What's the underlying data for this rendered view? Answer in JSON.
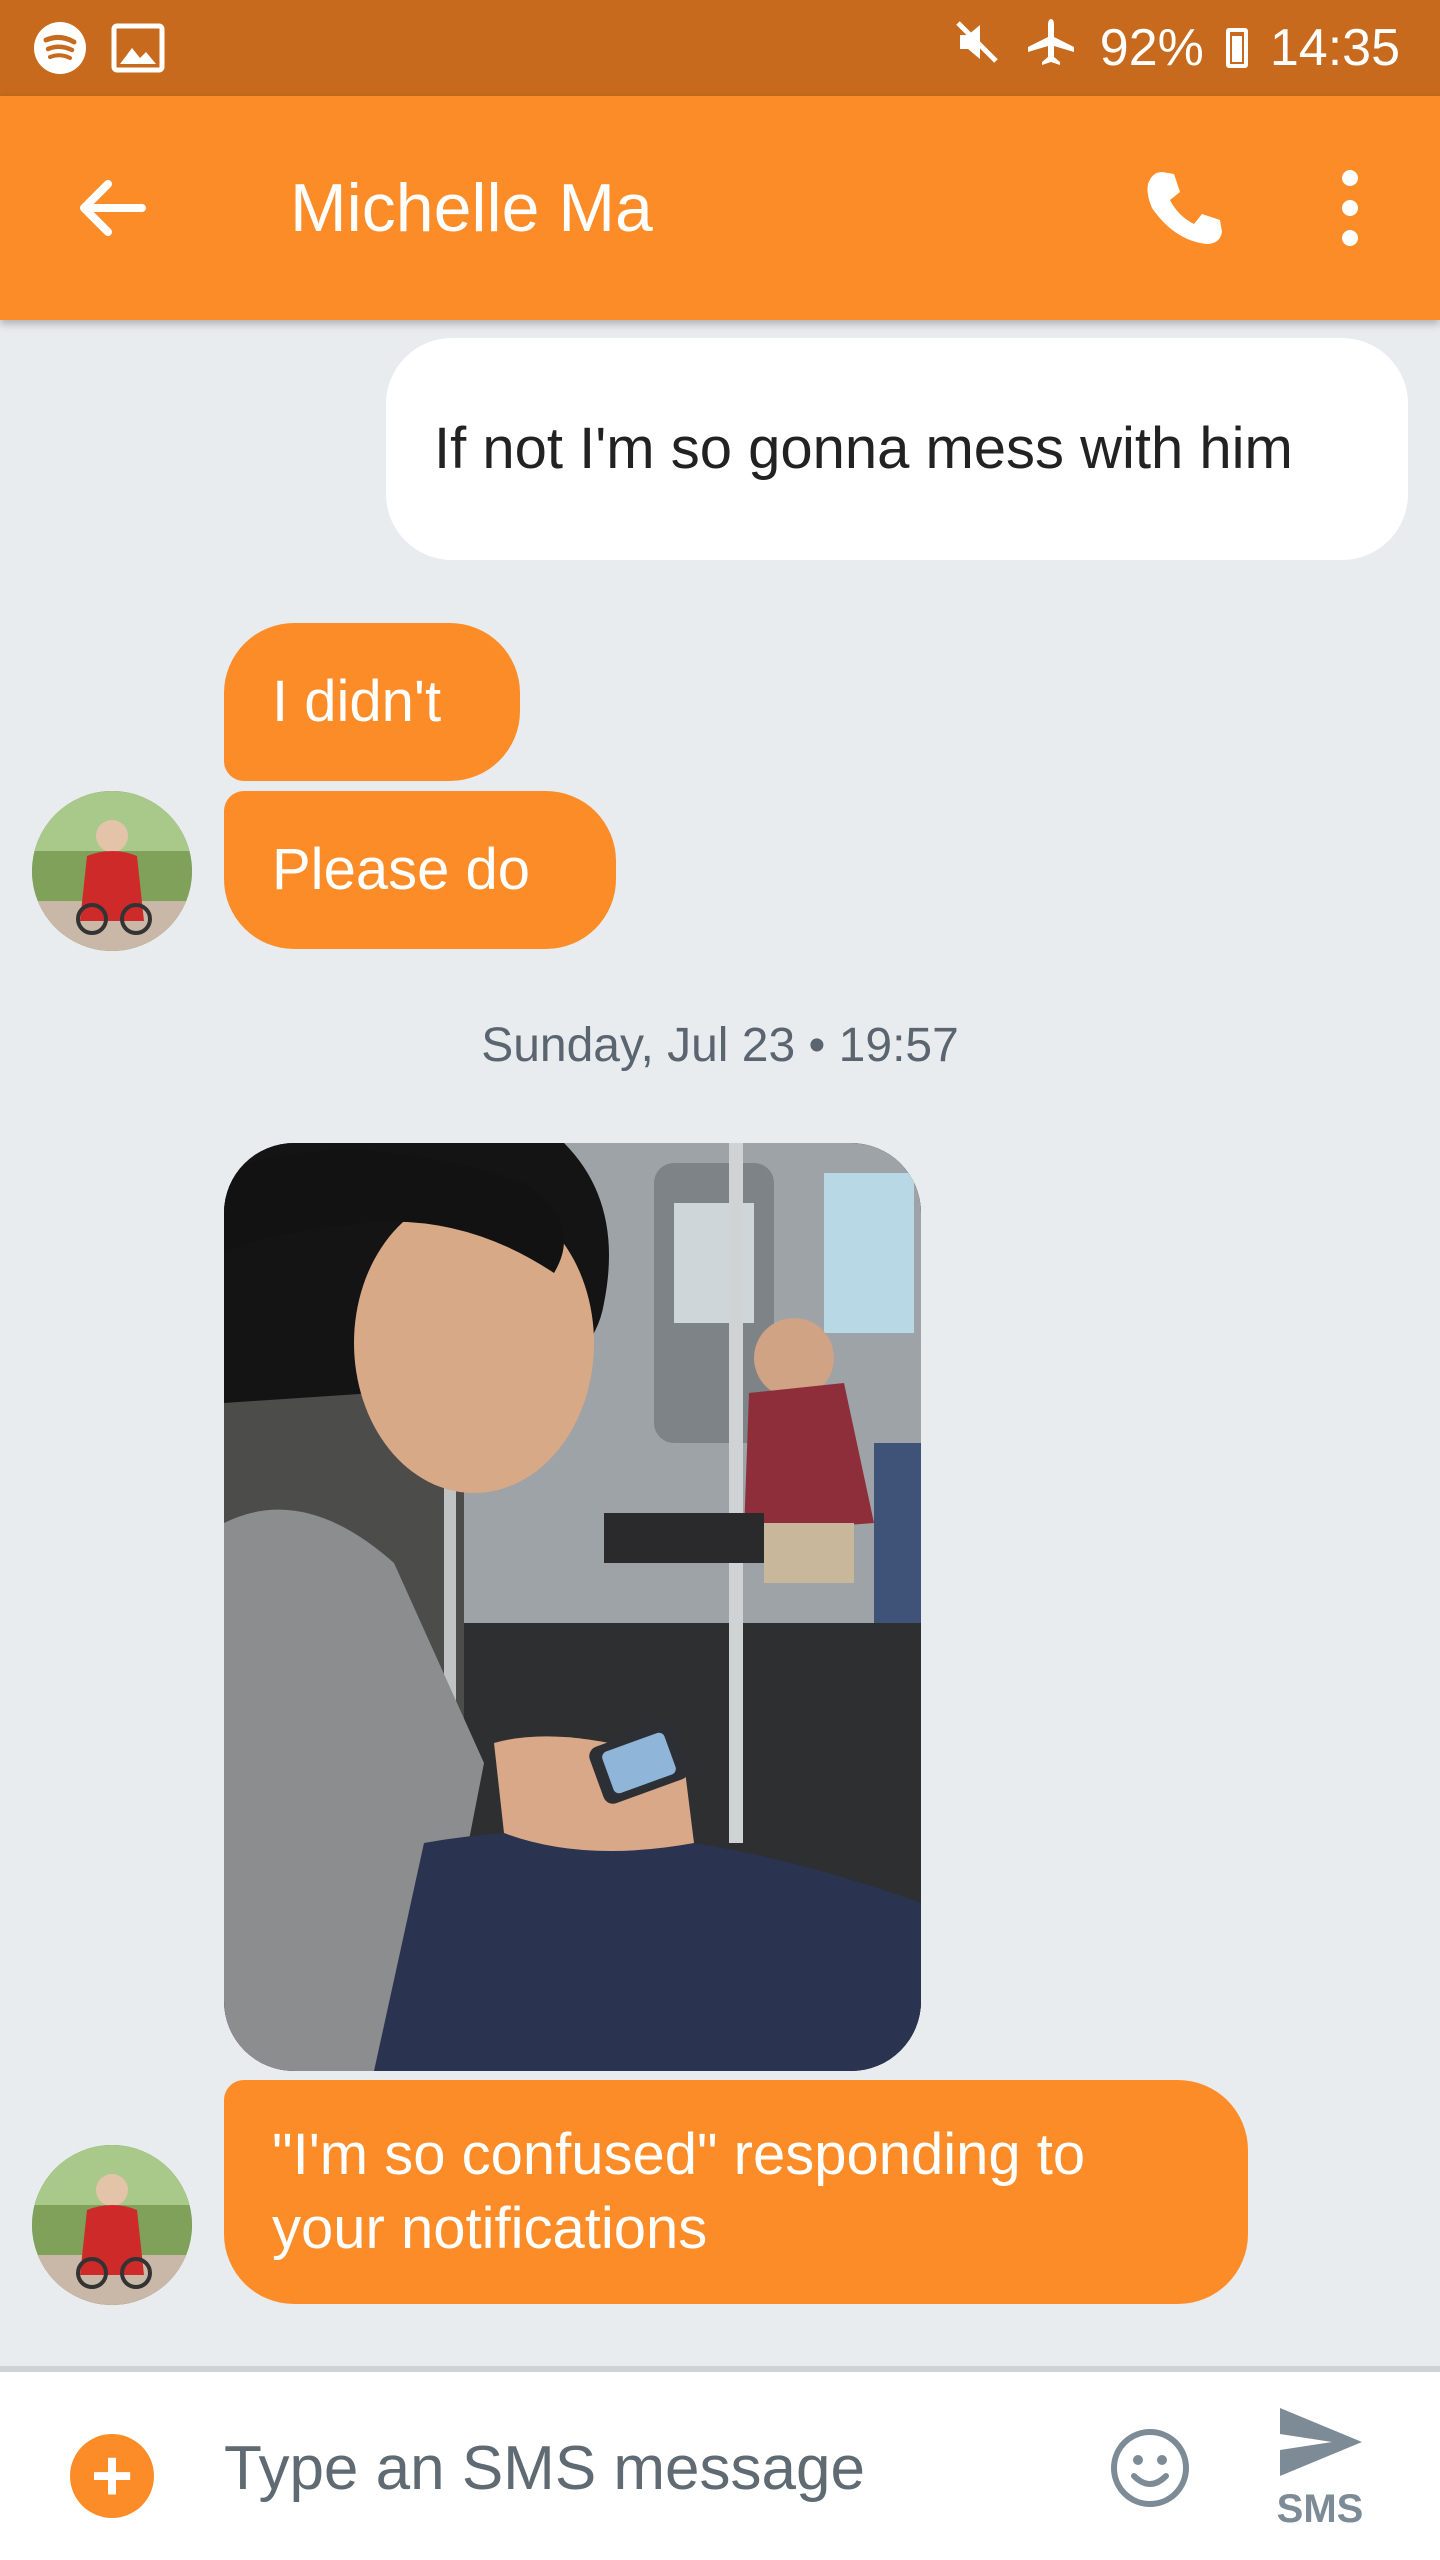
{
  "status_bar": {
    "battery": "92%",
    "time": "14:35",
    "icons": [
      "spotify-icon",
      "image-icon",
      "mute-icon",
      "airplane-icon",
      "battery-icon"
    ]
  },
  "header": {
    "title": "Michelle Ma",
    "back_icon": "arrow-back-icon",
    "call_icon": "phone-icon",
    "more_icon": "more-vert-icon"
  },
  "messages": [
    {
      "direction": "outgoing",
      "text": "If not I'm so gonna mess with him"
    },
    {
      "direction": "incoming",
      "text": "I didn't"
    },
    {
      "direction": "incoming",
      "text": "Please do"
    },
    {
      "direction": "incoming",
      "type": "image"
    },
    {
      "direction": "incoming",
      "text": "\"I'm so confused\" responding to your notifications"
    }
  ],
  "timestamp": "Sunday, Jul 23 • 19:57",
  "composer": {
    "placeholder": "Type an SMS message",
    "send_label": "SMS"
  },
  "colors": {
    "app_bar": "#fb8c28",
    "status_bar": "#c76a1d",
    "background": "#e9ecef"
  }
}
